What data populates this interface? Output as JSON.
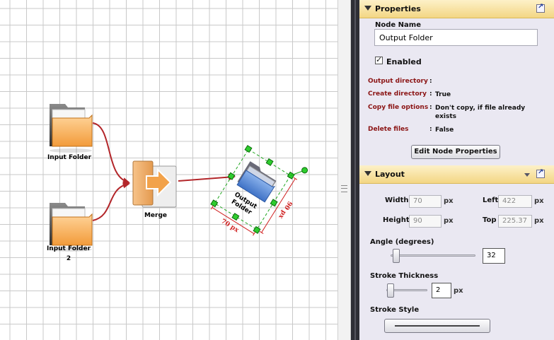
{
  "canvas": {
    "nodes": [
      {
        "id": "input1",
        "label": "Input Folder",
        "icon": "folder-icon"
      },
      {
        "id": "input2",
        "label": "Input Folder 2",
        "icon": "folder-icon"
      },
      {
        "id": "merge",
        "label": "Merge",
        "icon": "merge-icon"
      },
      {
        "id": "output",
        "label": "Output Folder",
        "icon": "folder-icon",
        "selected": true
      }
    ],
    "selection": {
      "width_text": "70 px",
      "height_text": "90 px"
    }
  },
  "properties": {
    "header": "Properties",
    "node_name_label": "Node Name",
    "node_name_value": "Output Folder",
    "enabled_label": "Enabled",
    "enabled": true,
    "rows": [
      {
        "key": "Output directory",
        "value": ""
      },
      {
        "key": "Create directory",
        "value": "True"
      },
      {
        "key": "Copy file options",
        "value": "Don't copy, if file already exists"
      },
      {
        "key": "Delete files",
        "value": "False"
      }
    ],
    "edit_button": "Edit Node Properties"
  },
  "layout": {
    "header": "Layout",
    "width_label": "Width",
    "width_value": "70",
    "height_label": "Height",
    "height_value": "90",
    "left_label": "Left",
    "left_value": "422",
    "top_label": "Top",
    "top_value": "225.37",
    "unit": "px",
    "angle_label": "Angle (degrees)",
    "angle_value": "32",
    "stroke_thickness_label": "Stroke Thickness",
    "stroke_thickness_value": "2",
    "stroke_style_label": "Stroke Style"
  },
  "colors": {
    "accent_red": "#b3262a",
    "selection_green": "#1ea51e",
    "header_gold": "#f3d684"
  }
}
